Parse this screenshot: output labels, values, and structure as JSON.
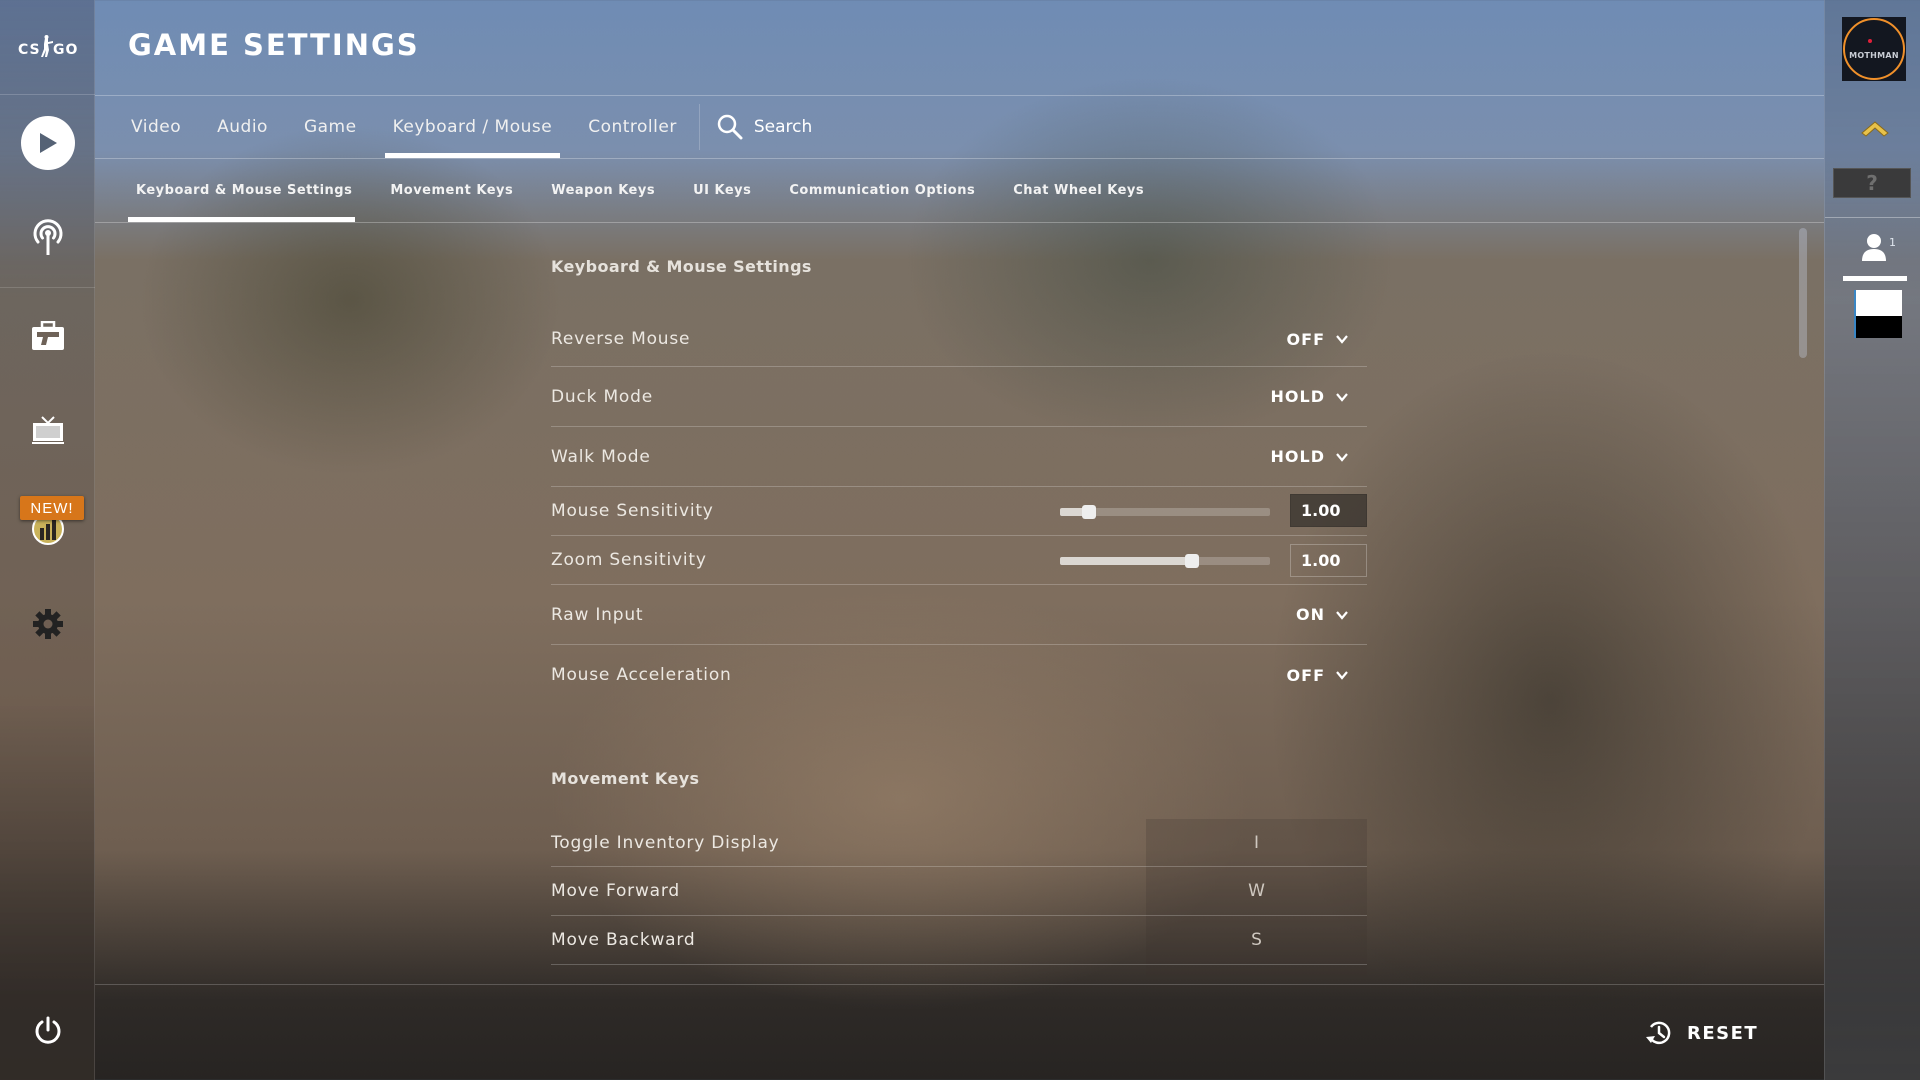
{
  "app": {
    "logo_text": "CS GO",
    "page_title": "GAME SETTINGS"
  },
  "sidebar": {
    "items": [
      {
        "name": "play",
        "icon": "play-icon"
      },
      {
        "name": "watch-broadcast",
        "icon": "broadcast-icon"
      },
      {
        "name": "inventory",
        "icon": "briefcase-gun-icon"
      },
      {
        "name": "watch",
        "icon": "tv-icon"
      },
      {
        "name": "operation",
        "icon": "operation-coin-icon",
        "badge": "NEW!"
      },
      {
        "name": "settings",
        "icon": "gear-icon"
      }
    ],
    "new_badge": "NEW!",
    "power_icon": "power-icon",
    "badge_color": "#d7761a"
  },
  "tabs": {
    "items": [
      "Video",
      "Audio",
      "Game",
      "Keyboard / Mouse",
      "Controller"
    ],
    "active": "Keyboard / Mouse",
    "search_label": "Search"
  },
  "subtabs": {
    "items": [
      "Keyboard & Mouse Settings",
      "Movement Keys",
      "Weapon Keys",
      "UI Keys",
      "Communication Options",
      "Chat Wheel Keys"
    ],
    "active": "Keyboard & Mouse Settings"
  },
  "sections": {
    "keyboard_mouse": {
      "title": "Keyboard & Mouse Settings",
      "reverse_mouse": {
        "label": "Reverse Mouse",
        "value": "OFF"
      },
      "duck_mode": {
        "label": "Duck Mode",
        "value": "HOLD"
      },
      "walk_mode": {
        "label": "Walk Mode",
        "value": "HOLD"
      },
      "mouse_sensitivity": {
        "label": "Mouse Sensitivity",
        "value": "1.00",
        "slider_percent": 14
      },
      "zoom_sensitivity": {
        "label": "Zoom Sensitivity",
        "value": "1.00",
        "slider_percent": 63
      },
      "raw_input": {
        "label": "Raw Input",
        "value": "ON"
      },
      "mouse_acceleration": {
        "label": "Mouse Acceleration",
        "value": "OFF"
      }
    },
    "movement_keys": {
      "title": "Movement Keys",
      "bindings": [
        {
          "label": "Toggle Inventory Display",
          "key": "I"
        },
        {
          "label": "Move Forward",
          "key": "W"
        },
        {
          "label": "Move Backward",
          "key": "S"
        }
      ]
    }
  },
  "footer": {
    "reset_label": "RESET"
  },
  "right_sidebar": {
    "avatar_text": "MOTHMAN",
    "avatar_ring_color": "#f0902a",
    "help_label": "?",
    "friend_count": "1"
  }
}
